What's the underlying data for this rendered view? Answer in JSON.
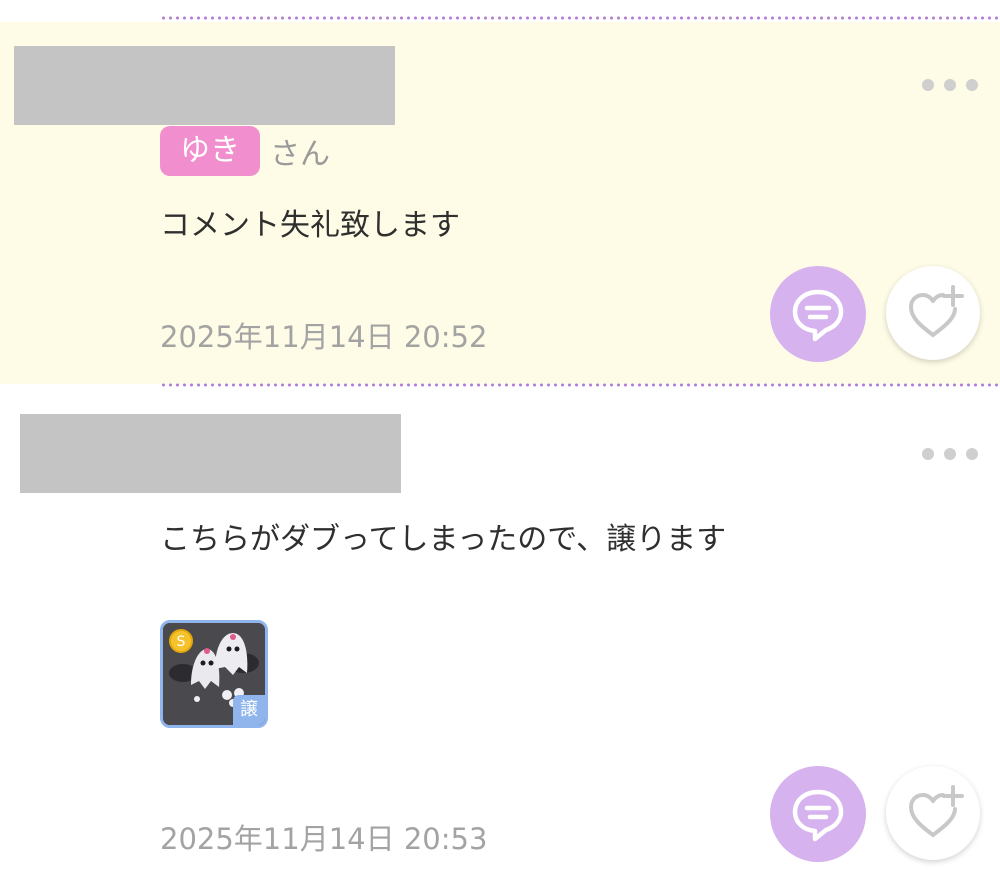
{
  "comments": [
    {
      "user_tag": "ゆき",
      "suffix": "さん",
      "text": "コメント失礼致します",
      "date": "2025年11月14日 20:52",
      "highlighted": true
    },
    {
      "text": "こちらがダブってしまったので、譲ります",
      "date": "2025年11月14日 20:53",
      "item": {
        "badge": "譲",
        "coin": "S"
      },
      "highlighted": false
    }
  ],
  "icons": [
    "more-icon",
    "reply-icon",
    "like-add-icon",
    "coin-icon"
  ],
  "colors": {
    "highlight_bg": "#fefce6",
    "name_tag": "#f18fce",
    "reply_button": "#d6b2ee",
    "divider": "#b57ed3",
    "item_border": "#8fb5ec"
  }
}
